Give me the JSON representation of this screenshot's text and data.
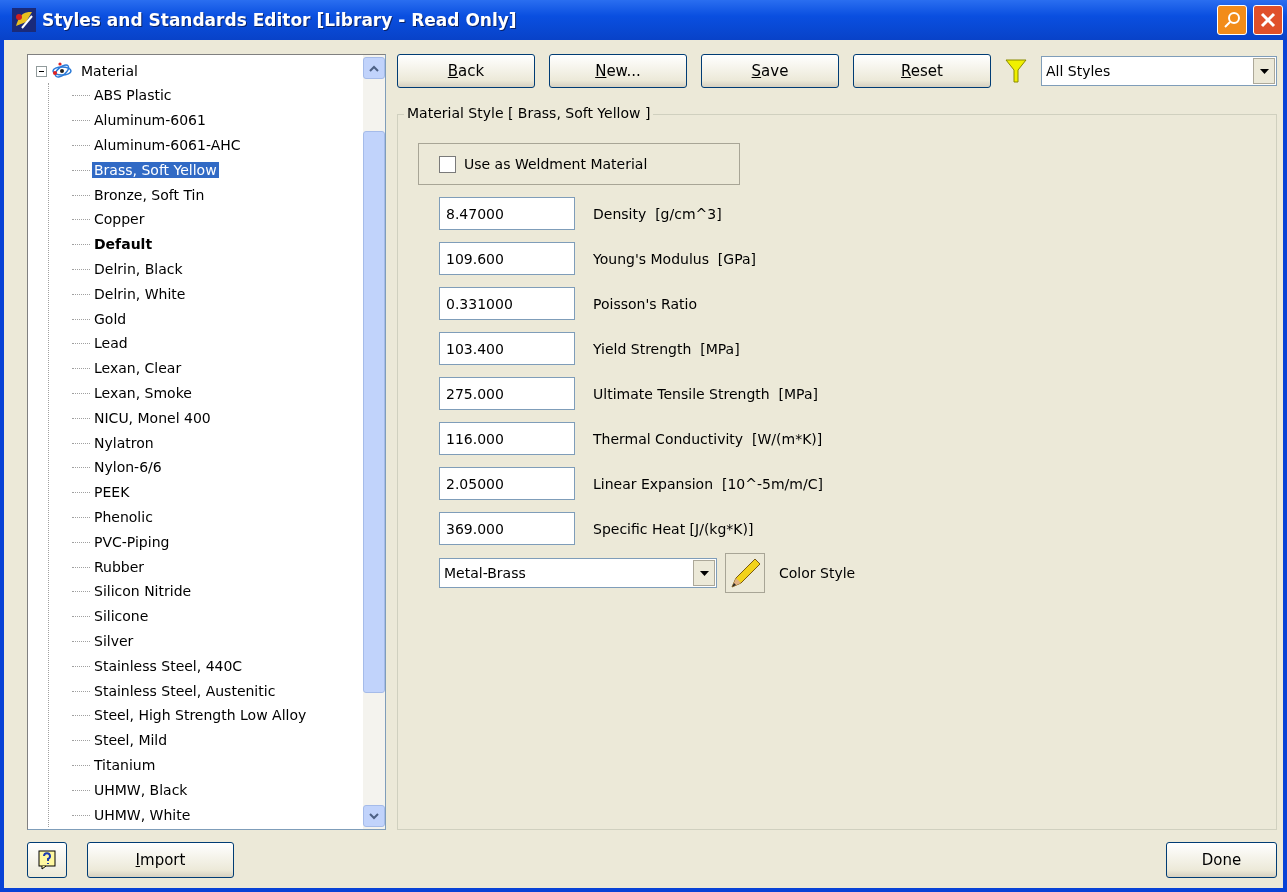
{
  "window": {
    "title": "Styles and Standards Editor [Library - Read Only]"
  },
  "tree": {
    "label": "Material",
    "expanded": true,
    "children": [
      {
        "label": "ABS Plastic",
        "selected": false,
        "default": false
      },
      {
        "label": "Aluminum-6061",
        "selected": false,
        "default": false
      },
      {
        "label": "Aluminum-6061-AHC",
        "selected": false,
        "default": false
      },
      {
        "label": "Brass, Soft Yellow",
        "selected": true,
        "default": false
      },
      {
        "label": "Bronze, Soft Tin",
        "selected": false,
        "default": false
      },
      {
        "label": "Copper",
        "selected": false,
        "default": false
      },
      {
        "label": "Default",
        "selected": false,
        "default": true
      },
      {
        "label": "Delrin, Black",
        "selected": false,
        "default": false
      },
      {
        "label": "Delrin, White",
        "selected": false,
        "default": false
      },
      {
        "label": "Gold",
        "selected": false,
        "default": false
      },
      {
        "label": "Lead",
        "selected": false,
        "default": false
      },
      {
        "label": "Lexan, Clear",
        "selected": false,
        "default": false
      },
      {
        "label": "Lexan, Smoke",
        "selected": false,
        "default": false
      },
      {
        "label": "NICU, Monel 400",
        "selected": false,
        "default": false
      },
      {
        "label": "Nylatron",
        "selected": false,
        "default": false
      },
      {
        "label": "Nylon-6/6",
        "selected": false,
        "default": false
      },
      {
        "label": "PEEK",
        "selected": false,
        "default": false
      },
      {
        "label": "Phenolic",
        "selected": false,
        "default": false
      },
      {
        "label": "PVC-Piping",
        "selected": false,
        "default": false
      },
      {
        "label": "Rubber",
        "selected": false,
        "default": false
      },
      {
        "label": "Silicon Nitride",
        "selected": false,
        "default": false
      },
      {
        "label": "Silicone",
        "selected": false,
        "default": false
      },
      {
        "label": "Silver",
        "selected": false,
        "default": false
      },
      {
        "label": "Stainless Steel, 440C",
        "selected": false,
        "default": false
      },
      {
        "label": "Stainless Steel, Austenitic",
        "selected": false,
        "default": false
      },
      {
        "label": "Steel, High Strength Low Alloy",
        "selected": false,
        "default": false
      },
      {
        "label": "Steel, Mild",
        "selected": false,
        "default": false
      },
      {
        "label": "Titanium",
        "selected": false,
        "default": false
      },
      {
        "label": "UHMW, Black",
        "selected": false,
        "default": false
      },
      {
        "label": "UHMW, White",
        "selected": false,
        "default": false
      }
    ]
  },
  "toolbar": {
    "buttons": [
      {
        "label": "Back"
      },
      {
        "label": "New..."
      },
      {
        "label": "Save"
      },
      {
        "label": "Reset"
      }
    ],
    "filter": {
      "value": "All Styles"
    }
  },
  "style_group": {
    "title": "Material Style [ Brass, Soft Yellow ]",
    "weldment": {
      "label": "Use as Weldment Material",
      "checked": false
    },
    "properties": [
      {
        "value": "8.47000",
        "label": "Density  [g/cm^3]"
      },
      {
        "value": "109.600",
        "label": "Young's Modulus  [GPa]"
      },
      {
        "value": "0.331000",
        "label": "Poisson's Ratio"
      },
      {
        "value": "103.400",
        "label": "Yield Strength  [MPa]"
      },
      {
        "value": "275.000",
        "label": "Ultimate Tensile Strength  [MPa]"
      },
      {
        "value": "116.000",
        "label": "Thermal Conductivity  [W/(m*K)]"
      },
      {
        "value": "2.05000",
        "label": "Linear Expansion  [10^-5m/m/C]"
      },
      {
        "value": "369.000",
        "label": "Specific Heat [J/(kg*K)]"
      }
    ],
    "color_style": {
      "value": "Metal-Brass",
      "label": "Color Style"
    }
  },
  "footer": {
    "import": {
      "label": "Import"
    },
    "done": {
      "label": "Done"
    }
  }
}
